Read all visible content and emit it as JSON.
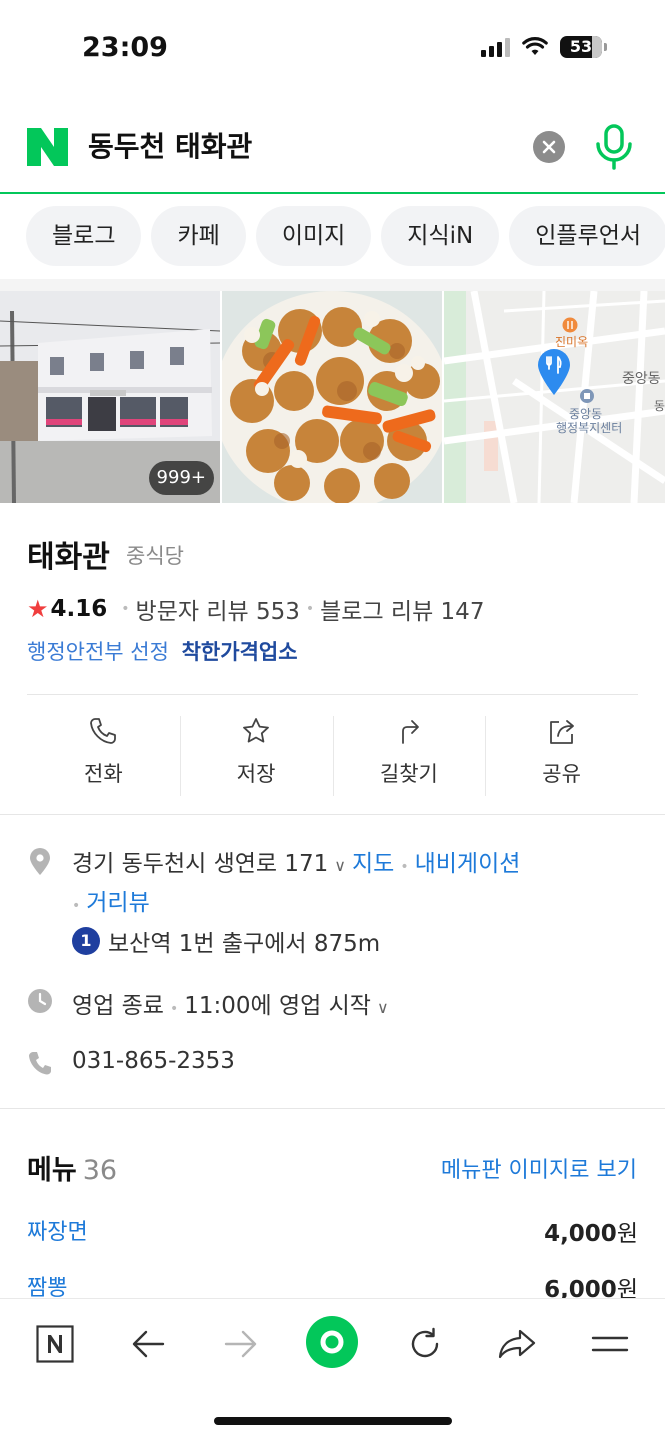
{
  "status_bar": {
    "time": "23:09",
    "battery": "53"
  },
  "search": {
    "query": "동두천 태화관"
  },
  "chips": [
    "블로그",
    "카페",
    "이미지",
    "지식iN",
    "인플루언서"
  ],
  "gallery": {
    "photo_count": "999+"
  },
  "place": {
    "name": "태화관",
    "category": "중식당",
    "rating": "4.16",
    "visitor_reviews": "방문자 리뷰 553",
    "blog_reviews": "블로그 리뷰 147",
    "gov_selected": "행정안전부 선정",
    "gov_badge": "착한가격업소"
  },
  "map": {
    "label_1": "진미옥",
    "label_2": "중앙동",
    "label_3": "중앙동",
    "label_4": "행정복지센터",
    "label_5": "동"
  },
  "actions": [
    {
      "label": "전화",
      "icon": "phone-icon"
    },
    {
      "label": "저장",
      "icon": "star-icon"
    },
    {
      "label": "길찾기",
      "icon": "directions-icon"
    },
    {
      "label": "공유",
      "icon": "share-icon"
    }
  ],
  "info": {
    "address": "경기 동두천시 생연로 171",
    "map_link": "지도",
    "navigation_link": "내비게이션",
    "street_view_link": "거리뷰",
    "subway_line": "1",
    "subway_info": "보산역 1번 출구에서 875m",
    "hours_status": "영업 종료",
    "hours_next": "11:00에 영업 시작",
    "phone": "031-865-2353"
  },
  "menu": {
    "title": "메뉴",
    "count": "36",
    "image_link": "메뉴판 이미지로 보기",
    "items": [
      {
        "name": "짜장면",
        "price": "4,000",
        "unit": "원"
      },
      {
        "name": "짬뽕",
        "price": "6,000",
        "unit": "원"
      }
    ]
  },
  "colors": {
    "naver_green": "#03c75a",
    "link_blue": "#1e7ad9",
    "star_red": "#f03e3e"
  }
}
